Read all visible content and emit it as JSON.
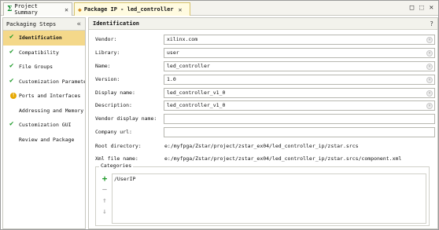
{
  "tabs": [
    {
      "label": "Project Summary",
      "icon": "sigma-icon",
      "active": false
    },
    {
      "label": "Package IP - led_controller",
      "icon": "package-icon",
      "active": true
    }
  ],
  "window_icons": [
    "restore-icon",
    "maximize-icon",
    "close-icon"
  ],
  "left_panel": {
    "title": "Packaging Steps",
    "steps": [
      {
        "label": "Identification",
        "status": "check",
        "active": true
      },
      {
        "label": "Compatibility",
        "status": "check",
        "active": false
      },
      {
        "label": "File Groups",
        "status": "check",
        "active": false
      },
      {
        "label": "Customization Parameter",
        "status": "check",
        "active": false
      },
      {
        "label": "Ports and Interfaces",
        "status": "warning",
        "active": false
      },
      {
        "label": "Addressing and Memory",
        "status": "none",
        "active": false
      },
      {
        "label": "Customization GUI",
        "status": "check",
        "active": false
      },
      {
        "label": "Review and Package",
        "status": "none",
        "active": false
      }
    ]
  },
  "main": {
    "title": "Identification",
    "help": "?",
    "fields": [
      {
        "label": "Vendor:",
        "value": "xilinx.com"
      },
      {
        "label": "Library:",
        "value": "user"
      },
      {
        "label": "Name:",
        "value": "led_controller"
      },
      {
        "label": "Version:",
        "value": "1.0"
      },
      {
        "label": "Display name:",
        "value": "led_controller_v1_0"
      },
      {
        "label": "Description:",
        "value": "led_controller_v1_0"
      },
      {
        "label": "Vendor display name:",
        "value": ""
      },
      {
        "label": "Company url:",
        "value": ""
      }
    ],
    "root_directory": {
      "label": "Root directory:",
      "value": "e:/myfpga/Zstar/project/zstar_ex04/led_controller_ip/zstar.srcs"
    },
    "xml_file": {
      "label": "Xml file name:",
      "value": "e:/myfpga/Zstar/project/zstar_ex04/led_controller_ip/zstar.srcs/component.xml"
    },
    "categories": {
      "title": "Categories",
      "items": [
        "/UserIP"
      ]
    }
  },
  "colors": {
    "active_step": "#f4d88a",
    "check": "#1f9a2a",
    "warning": "#e6a800",
    "active_tab": "#fffbe0"
  }
}
